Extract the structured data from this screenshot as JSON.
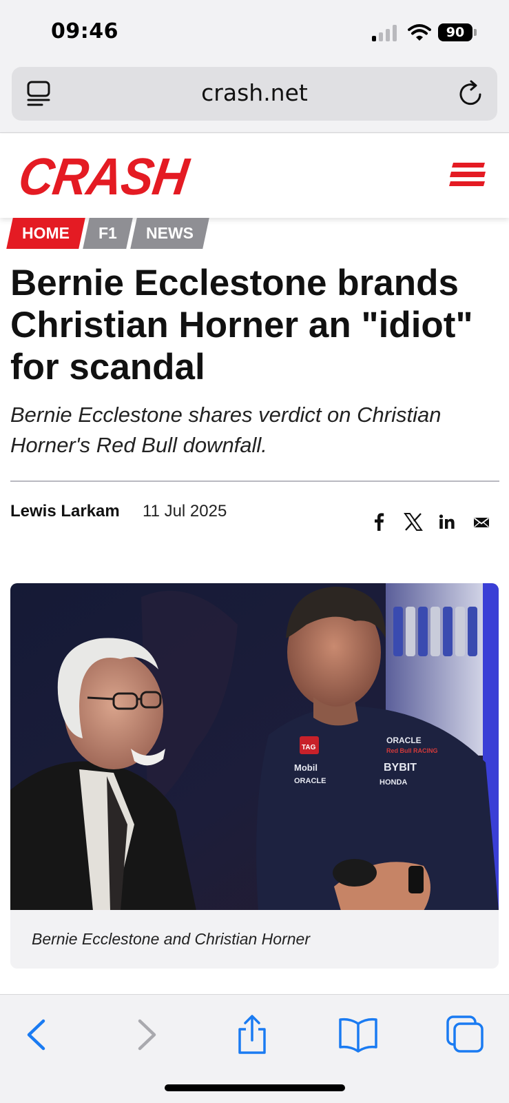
{
  "status_bar": {
    "time": "09:46",
    "battery": "90"
  },
  "address_bar": {
    "url": "crash.net"
  },
  "site": {
    "logo": "CRASH",
    "brand_color": "#e41b23"
  },
  "breadcrumb": [
    "HOME",
    "F1",
    "NEWS"
  ],
  "article": {
    "title": "Bernie Ecclestone brands Christian Horner an \"idiot\" for scandal",
    "standfirst": "Bernie Ecclestone shares verdict on Christian Horner's Red Bull downfall.",
    "author": "Lewis Larkam",
    "date": "11 Jul 2025",
    "share": [
      "facebook-icon",
      "x-icon",
      "linkedin-icon",
      "email-icon"
    ],
    "image_caption": "Bernie Ecclestone and Christian Horner",
    "shirt_sponsors": [
      "TAG HEUER",
      "Mobil",
      "ORACLE",
      "ORACLE Red Bull RACING",
      "BYBIT",
      "HONDA"
    ]
  },
  "toolbar": {
    "icons": [
      "back-icon",
      "forward-icon",
      "share-icon",
      "bookmarks-icon",
      "tabs-icon"
    ],
    "accent": "#1a7bf2"
  }
}
